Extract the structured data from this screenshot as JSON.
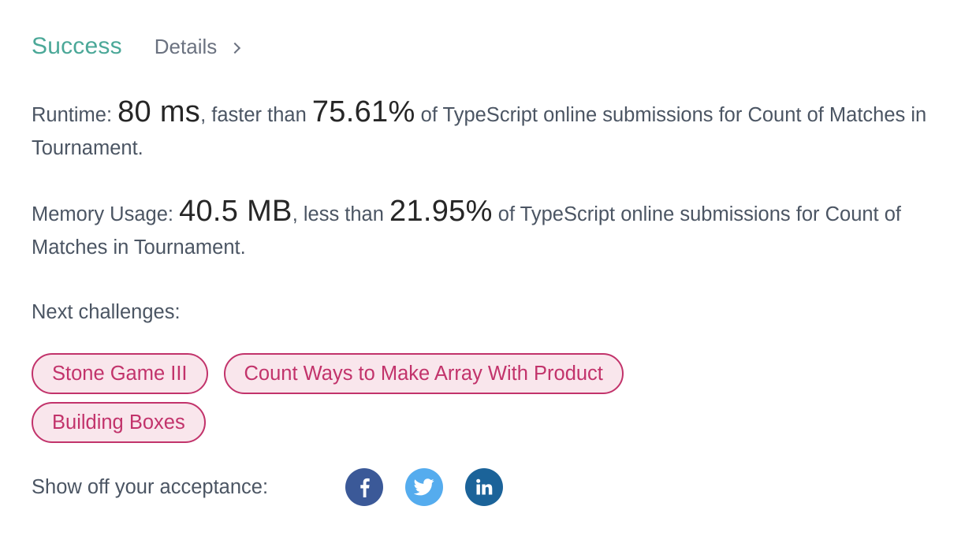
{
  "header": {
    "status": "Success",
    "details_label": "Details"
  },
  "runtime": {
    "label": "Runtime: ",
    "value": "80 ms",
    "comparison": ", faster than ",
    "percent": "75.61%",
    "suffix": " of TypeScript online submissions for Count of Matches in Tournament."
  },
  "memory": {
    "label": "Memory Usage: ",
    "value": "40.5 MB",
    "comparison": ", less than ",
    "percent": "21.95%",
    "suffix": " of TypeScript online submissions for Count of Matches in Tournament."
  },
  "next": {
    "label": "Next challenges:",
    "challenges": [
      "Stone Game III",
      "Count Ways to Make Array With Product",
      "Building Boxes"
    ]
  },
  "share": {
    "label": "Show off your acceptance:",
    "icons": [
      "facebook-icon",
      "twitter-icon",
      "linkedin-icon"
    ],
    "colors": {
      "facebook": "#3b5998",
      "twitter": "#55acee",
      "linkedin": "#1b6399"
    }
  },
  "colors": {
    "success": "#4ba898",
    "chip_text": "#c2336b",
    "chip_bg": "#f9e6ec"
  }
}
